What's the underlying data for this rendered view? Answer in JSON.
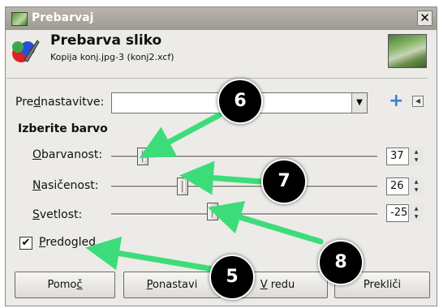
{
  "window": {
    "title": "Prebarvaj",
    "close_label": "✕"
  },
  "header": {
    "title": "Prebarva sliko",
    "subtitle": "Kopija konj.jpg-3 (konj2.xcf)"
  },
  "presets": {
    "label_pre": "Pre",
    "label_accel": "d",
    "label_post": "nastavitve:",
    "value": "",
    "dropdown_icon": "▼",
    "add_icon": "+",
    "menu_icon": "◀"
  },
  "section_title": "Izberite barvo",
  "sliders": [
    {
      "accel": "O",
      "rest": "barvanost:",
      "value": "37",
      "level": 37
    },
    {
      "accel": "N",
      "rest": "asičenost:",
      "value": "26",
      "level": 26
    },
    {
      "accel": "S",
      "rest": "vetlost:",
      "value": "-25",
      "level": -25
    }
  ],
  "preview": {
    "checked": true,
    "check_mark": "✔",
    "accel": "P",
    "rest": "redogled"
  },
  "buttons": {
    "help": {
      "pre": "Pomo",
      "accel": "č",
      "post": ""
    },
    "reset": {
      "pre": "",
      "accel": "P",
      "post": "onastavi"
    },
    "ok": {
      "pre": "",
      "accel": "V",
      "post": " redu"
    },
    "cancel": {
      "pre": "Prekliči",
      "accel": "",
      "post": ""
    }
  },
  "callouts": [
    "6",
    "7",
    "8",
    "5"
  ],
  "colors": {
    "arrow": "#3ddc7a",
    "bubble": "#000000"
  }
}
